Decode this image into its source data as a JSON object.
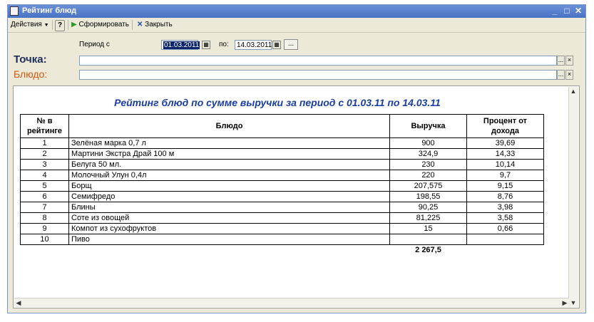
{
  "window": {
    "title": "Рейтинг блюд"
  },
  "toolbar": {
    "actions": "Действия",
    "help": "?",
    "generate": "Сформировать",
    "close": "Закрыть"
  },
  "period": {
    "from_label": "Период с",
    "from_value": "01.03.2011",
    "to_label": "по:",
    "to_value": "14.03.2011",
    "more": "..."
  },
  "filters": {
    "point_label": "Точка:",
    "point_value": "",
    "dish_label": "Блюдо:",
    "dish_value": "",
    "select_btn": "...",
    "clear_btn": "×"
  },
  "report": {
    "title": "Рейтинг блюд по сумме выручки за период с 01.03.11 по 14.03.11",
    "headers": {
      "rank": "№ в рейтинге",
      "dish": "Блюдо",
      "revenue": "Выручка",
      "percent": "Процент от дохода"
    },
    "rows": [
      {
        "rank": "1",
        "dish": "Зелёная марка 0,7 л",
        "revenue": "900",
        "percent": "39,69"
      },
      {
        "rank": "2",
        "dish": "Мартини Экстра Драй 100 м",
        "revenue": "324,9",
        "percent": "14,33"
      },
      {
        "rank": "3",
        "dish": "Белуга 50 мл.",
        "revenue": "230",
        "percent": "10,14"
      },
      {
        "rank": "4",
        "dish": "Молочный Улун 0,4л",
        "revenue": "220",
        "percent": "9,7"
      },
      {
        "rank": "5",
        "dish": "Борщ",
        "revenue": "207,575",
        "percent": "9,15"
      },
      {
        "rank": "6",
        "dish": "Семифредо",
        "revenue": "198,55",
        "percent": "8,76"
      },
      {
        "rank": "7",
        "dish": "Блины",
        "revenue": "90,25",
        "percent": "3,98"
      },
      {
        "rank": "8",
        "dish": "Соте из овощей",
        "revenue": "81,225",
        "percent": "3,58"
      },
      {
        "rank": "9",
        "dish": "Компот из сухофруктов",
        "revenue": "15",
        "percent": "0,66"
      },
      {
        "rank": "10",
        "dish": "Пиво",
        "revenue": "",
        "percent": ""
      }
    ],
    "total": "2 267,5"
  }
}
